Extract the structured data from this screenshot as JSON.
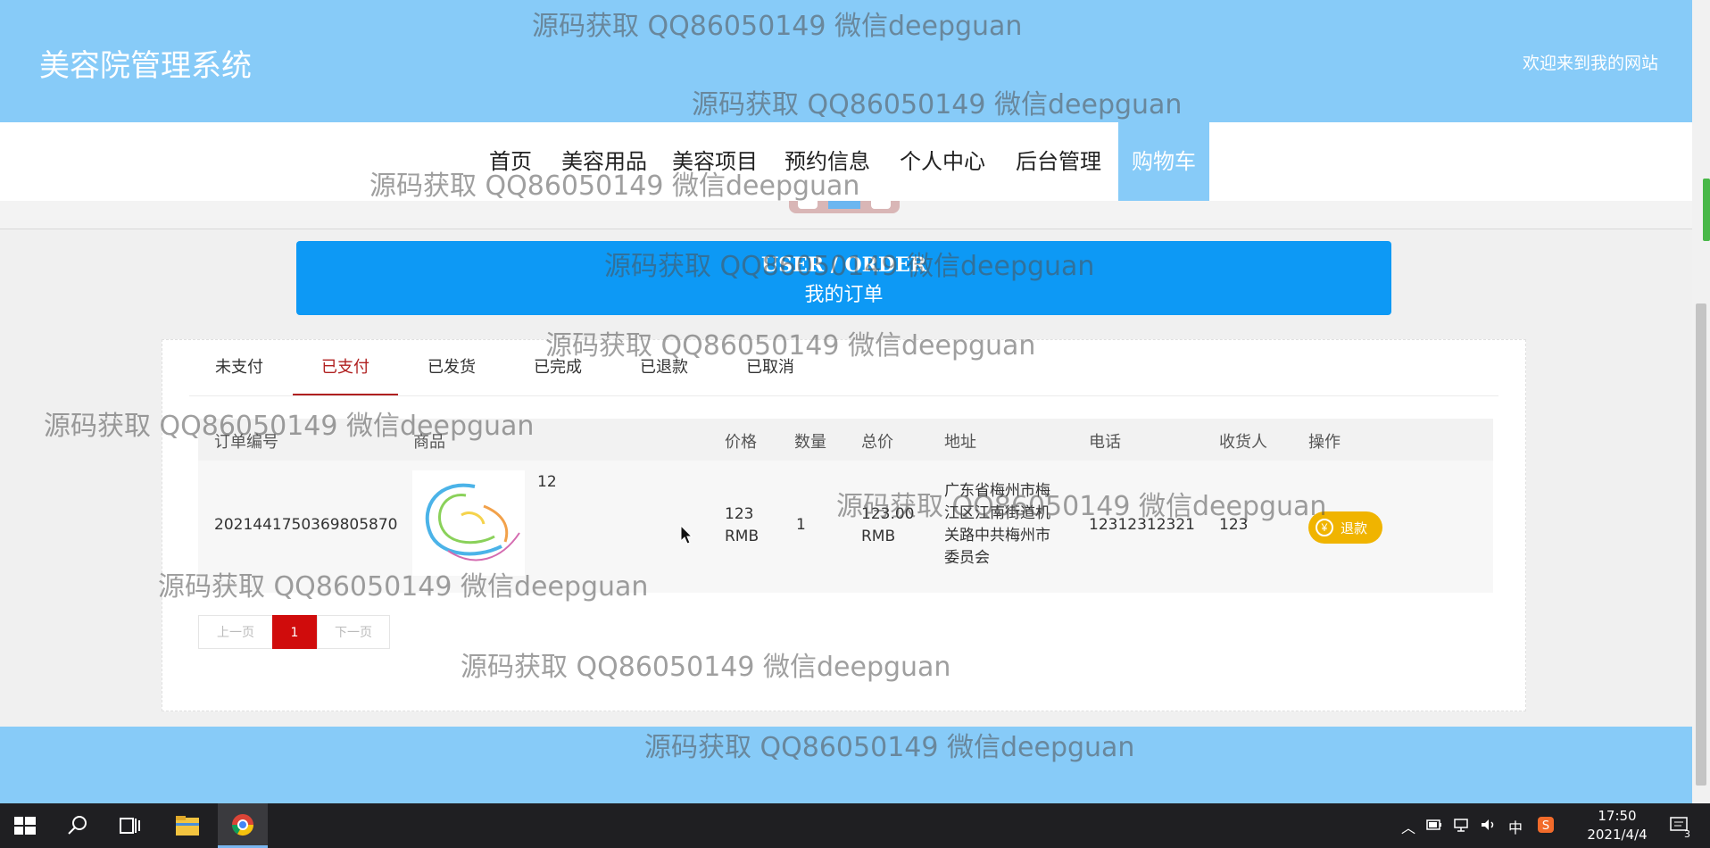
{
  "header": {
    "title": "美容院管理系统",
    "welcome": "欢迎来到我的网站"
  },
  "nav": [
    {
      "label": "首页",
      "active": false
    },
    {
      "label": "美容用品",
      "active": false
    },
    {
      "label": "美容项目",
      "active": false
    },
    {
      "label": "预约信息",
      "active": false
    },
    {
      "label": "个人中心",
      "active": false
    },
    {
      "label": "后台管理",
      "active": false
    },
    {
      "label": "购物车",
      "active": true
    }
  ],
  "banner": {
    "en": "USER / ORDER",
    "zh": "我的订单"
  },
  "tabs": [
    {
      "label": "未支付",
      "active": false
    },
    {
      "label": "已支付",
      "active": true
    },
    {
      "label": "已发货",
      "active": false
    },
    {
      "label": "已完成",
      "active": false
    },
    {
      "label": "已退款",
      "active": false
    },
    {
      "label": "已取消",
      "active": false
    }
  ],
  "table": {
    "headers": [
      "订单编号",
      "商品",
      "价格",
      "数量",
      "总价",
      "地址",
      "电话",
      "收货人",
      "操作"
    ],
    "rows": [
      {
        "order_no": "2021441750369805870",
        "product_name": "12",
        "price": "123 RMB",
        "quantity": "1",
        "total": "123.00 RMB",
        "address": "广东省梅州市梅江区江南街道机关路中共梅州市委员会",
        "phone": "12312312321",
        "receiver": "123",
        "action_label": "退款"
      }
    ]
  },
  "pagination": {
    "prev": "上一页",
    "current": "1",
    "next": "下一页"
  },
  "watermark": "源码获取 QQ86050149 微信deepguan",
  "taskbar": {
    "ime": "中",
    "time": "17:50",
    "date": "2021/4/4",
    "notification_count": "3"
  },
  "colors": {
    "header_bg": "#87cbf8",
    "banner_bg": "#0d99f5",
    "active_tab": "#b02020",
    "refund_button": "#f0b400",
    "page_current": "#d00c0c"
  },
  "icons": {
    "taskbar": [
      "windows-start-icon",
      "search-icon",
      "task-view-icon",
      "file-explorer-icon",
      "chrome-icon"
    ],
    "tray": [
      "chevron-up-icon",
      "battery-icon",
      "network-icon",
      "volume-icon",
      "sogou-ime-icon",
      "notification-icon"
    ]
  }
}
